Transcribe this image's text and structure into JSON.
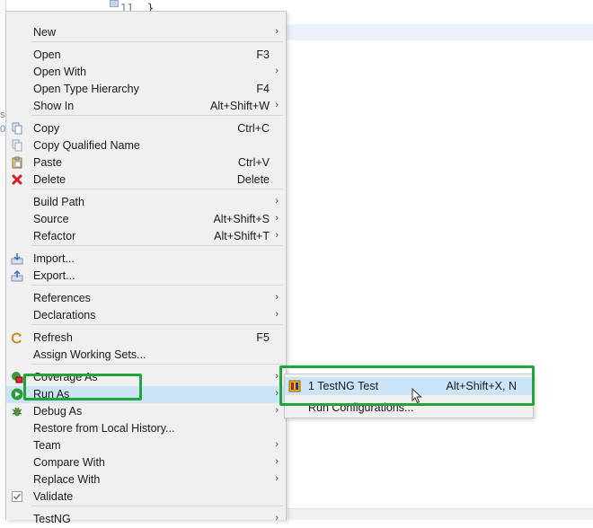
{
  "editor": {
    "line_number": "11",
    "code": "}"
  },
  "left_stub": {
    "char_a": "0",
    "char_b": "s"
  },
  "menu": {
    "items": [
      {
        "label": "New",
        "shortcut": "",
        "submenu": true
      },
      {
        "label": "Open",
        "shortcut": "F3",
        "submenu": false
      },
      {
        "label": "Open With",
        "shortcut": "",
        "submenu": true
      },
      {
        "label": "Open Type Hierarchy",
        "shortcut": "F4",
        "submenu": false
      },
      {
        "label": "Show In",
        "shortcut": "Alt+Shift+W",
        "submenu": true
      },
      {
        "label": "Copy",
        "shortcut": "Ctrl+C",
        "submenu": false,
        "icon": "copy-icon"
      },
      {
        "label": "Copy Qualified Name",
        "shortcut": "",
        "submenu": false,
        "icon": "copy-qualified-icon"
      },
      {
        "label": "Paste",
        "shortcut": "Ctrl+V",
        "submenu": false,
        "icon": "paste-icon"
      },
      {
        "label": "Delete",
        "shortcut": "Delete",
        "submenu": false,
        "icon": "delete-icon"
      },
      {
        "label": "Build Path",
        "shortcut": "",
        "submenu": true
      },
      {
        "label": "Source",
        "shortcut": "Alt+Shift+S",
        "submenu": true
      },
      {
        "label": "Refactor",
        "shortcut": "Alt+Shift+T",
        "submenu": true
      },
      {
        "label": "Import...",
        "shortcut": "",
        "submenu": false,
        "icon": "import-icon"
      },
      {
        "label": "Export...",
        "shortcut": "",
        "submenu": false,
        "icon": "export-icon"
      },
      {
        "label": "References",
        "shortcut": "",
        "submenu": true
      },
      {
        "label": "Declarations",
        "shortcut": "",
        "submenu": true
      },
      {
        "label": "Refresh",
        "shortcut": "F5",
        "submenu": false,
        "icon": "refresh-icon"
      },
      {
        "label": "Assign Working Sets...",
        "shortcut": "",
        "submenu": false
      },
      {
        "label": "Coverage As",
        "shortcut": "",
        "submenu": true,
        "icon": "coverage-icon"
      },
      {
        "label": "Run As",
        "shortcut": "",
        "submenu": true,
        "icon": "run-icon",
        "selected": true
      },
      {
        "label": "Debug As",
        "shortcut": "",
        "submenu": true,
        "icon": "debug-icon"
      },
      {
        "label": "Restore from Local History...",
        "shortcut": "",
        "submenu": false
      },
      {
        "label": "Team",
        "shortcut": "",
        "submenu": true
      },
      {
        "label": "Compare With",
        "shortcut": "",
        "submenu": true
      },
      {
        "label": "Replace With",
        "shortcut": "",
        "submenu": true
      },
      {
        "label": "Validate",
        "shortcut": "",
        "submenu": false,
        "icon": "validate-icon"
      },
      {
        "label": "TestNG",
        "shortcut": "",
        "submenu": true
      }
    ],
    "arrow_glyph": "›"
  },
  "submenu": {
    "items": [
      {
        "label": "1 TestNG Test",
        "shortcut": "Alt+Shift+X, N",
        "icon": "testng-icon",
        "selected": true
      },
      {
        "label": "Run Configurations...",
        "shortcut": ""
      }
    ]
  },
  "colors": {
    "menu_bg": "#f0f0f0",
    "selection": "#cce4f7",
    "highlight_box": "#1fa53a"
  }
}
